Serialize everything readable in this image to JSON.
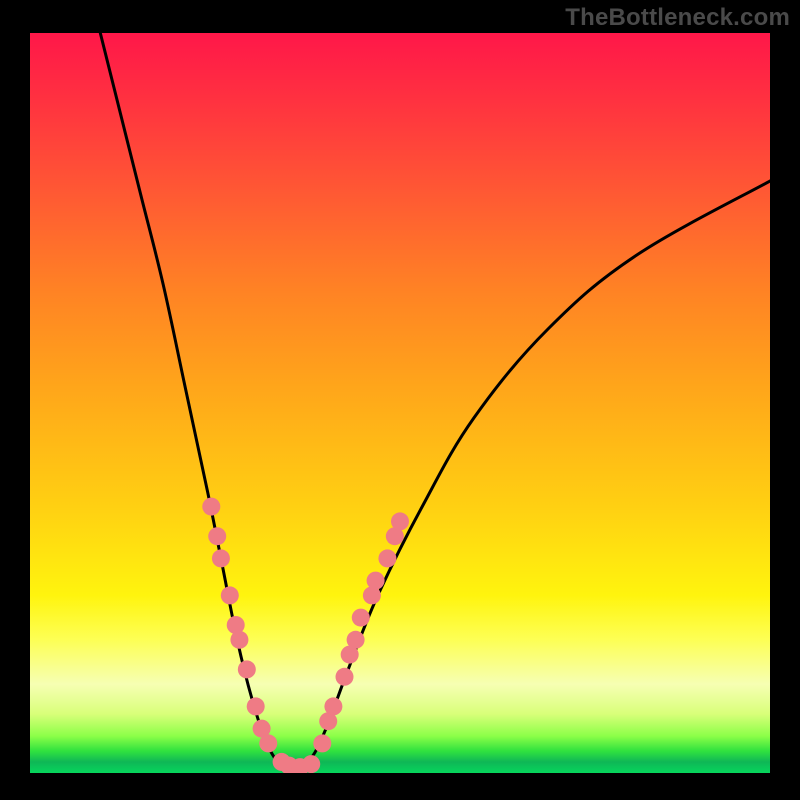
{
  "attribution": "TheBottleneck.com",
  "chart_data": {
    "type": "line",
    "title": "",
    "xlabel": "",
    "ylabel": "",
    "xlim": [
      0,
      100
    ],
    "ylim": [
      0,
      100
    ],
    "curve_left": {
      "name": "left-branch",
      "points": [
        {
          "x": 9.5,
          "y": 100
        },
        {
          "x": 12.0,
          "y": 90
        },
        {
          "x": 15.0,
          "y": 78
        },
        {
          "x": 18.0,
          "y": 66
        },
        {
          "x": 21.0,
          "y": 52
        },
        {
          "x": 24.0,
          "y": 38
        },
        {
          "x": 26.0,
          "y": 28
        },
        {
          "x": 28.0,
          "y": 18
        },
        {
          "x": 30.0,
          "y": 10
        },
        {
          "x": 32.0,
          "y": 4
        },
        {
          "x": 34.0,
          "y": 1
        },
        {
          "x": 36.0,
          "y": 0.5
        }
      ]
    },
    "curve_right": {
      "name": "right-branch",
      "points": [
        {
          "x": 36.0,
          "y": 0.5
        },
        {
          "x": 38.0,
          "y": 2
        },
        {
          "x": 40.0,
          "y": 6
        },
        {
          "x": 43.0,
          "y": 14
        },
        {
          "x": 47.0,
          "y": 24
        },
        {
          "x": 53.0,
          "y": 36
        },
        {
          "x": 60.0,
          "y": 48
        },
        {
          "x": 70.0,
          "y": 60
        },
        {
          "x": 82.0,
          "y": 70
        },
        {
          "x": 100.0,
          "y": 80
        }
      ]
    },
    "markers_left": {
      "name": "left-dots",
      "color": "#ef7b85",
      "points": [
        {
          "x": 24.5,
          "y": 36
        },
        {
          "x": 25.3,
          "y": 32
        },
        {
          "x": 25.8,
          "y": 29
        },
        {
          "x": 27.0,
          "y": 24
        },
        {
          "x": 27.8,
          "y": 20
        },
        {
          "x": 28.3,
          "y": 18
        },
        {
          "x": 29.3,
          "y": 14
        },
        {
          "x": 30.5,
          "y": 9
        },
        {
          "x": 31.3,
          "y": 6
        },
        {
          "x": 32.2,
          "y": 4
        },
        {
          "x": 34.0,
          "y": 1.5
        },
        {
          "x": 35.0,
          "y": 1.0
        },
        {
          "x": 36.5,
          "y": 0.8
        },
        {
          "x": 38.0,
          "y": 1.2
        }
      ]
    },
    "markers_right": {
      "name": "right-dots",
      "color": "#ef7b85",
      "points": [
        {
          "x": 39.5,
          "y": 4
        },
        {
          "x": 40.3,
          "y": 7
        },
        {
          "x": 41.0,
          "y": 9
        },
        {
          "x": 42.5,
          "y": 13
        },
        {
          "x": 43.2,
          "y": 16
        },
        {
          "x": 44.0,
          "y": 18
        },
        {
          "x": 44.7,
          "y": 21
        },
        {
          "x": 46.2,
          "y": 24
        },
        {
          "x": 46.7,
          "y": 26
        },
        {
          "x": 48.3,
          "y": 29
        },
        {
          "x": 49.3,
          "y": 32
        },
        {
          "x": 50.0,
          "y": 34
        }
      ]
    }
  }
}
